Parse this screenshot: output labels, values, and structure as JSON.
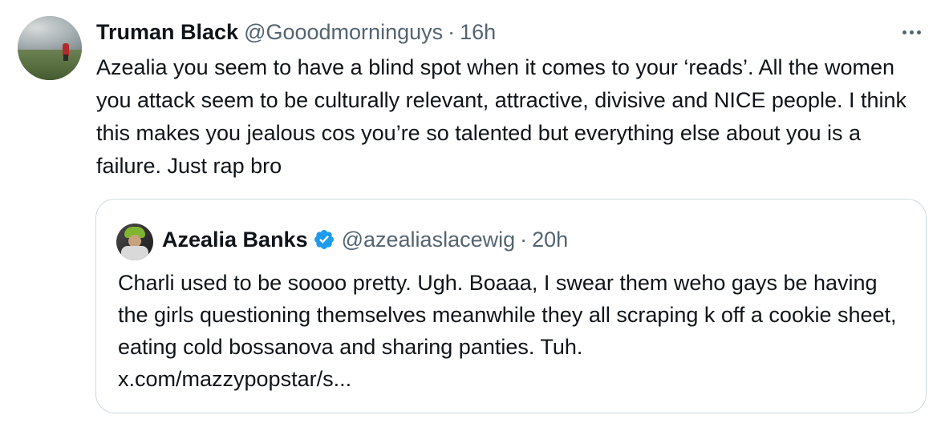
{
  "tweet": {
    "author": {
      "name": "Truman Black",
      "handle": "@Gooodmorninguys",
      "separator": "·",
      "time": "16h"
    },
    "text": "Azealia you seem to have a blind spot when it comes to your ‘reads’. All the women you attack seem to be culturally relevant, attractive, divisive and NICE people. I think this makes you jealous cos you’re so talented but everything else about you is a failure. Just rap bro"
  },
  "quoted_tweet": {
    "author": {
      "name": "Azealia Banks",
      "handle": "@azealiaslacewig",
      "separator": "·",
      "time": "20h",
      "verified": true
    },
    "text": "Charli used to be soooo pretty. Ugh. Boaaa, I swear them weho gays be having the girls questioning themselves meanwhile they all scraping k off a cookie sheet, eating cold bossanova and sharing panties. Tuh.",
    "link": "x.com/mazzypopstar/s..."
  },
  "icons": {
    "more": "more-horizontal-icon",
    "verified": "verified-badge-icon"
  },
  "colors": {
    "primary_text": "#0f1419",
    "secondary_text": "#536471",
    "border": "#cfd9de",
    "verified_blue": "#1d9bf0"
  }
}
